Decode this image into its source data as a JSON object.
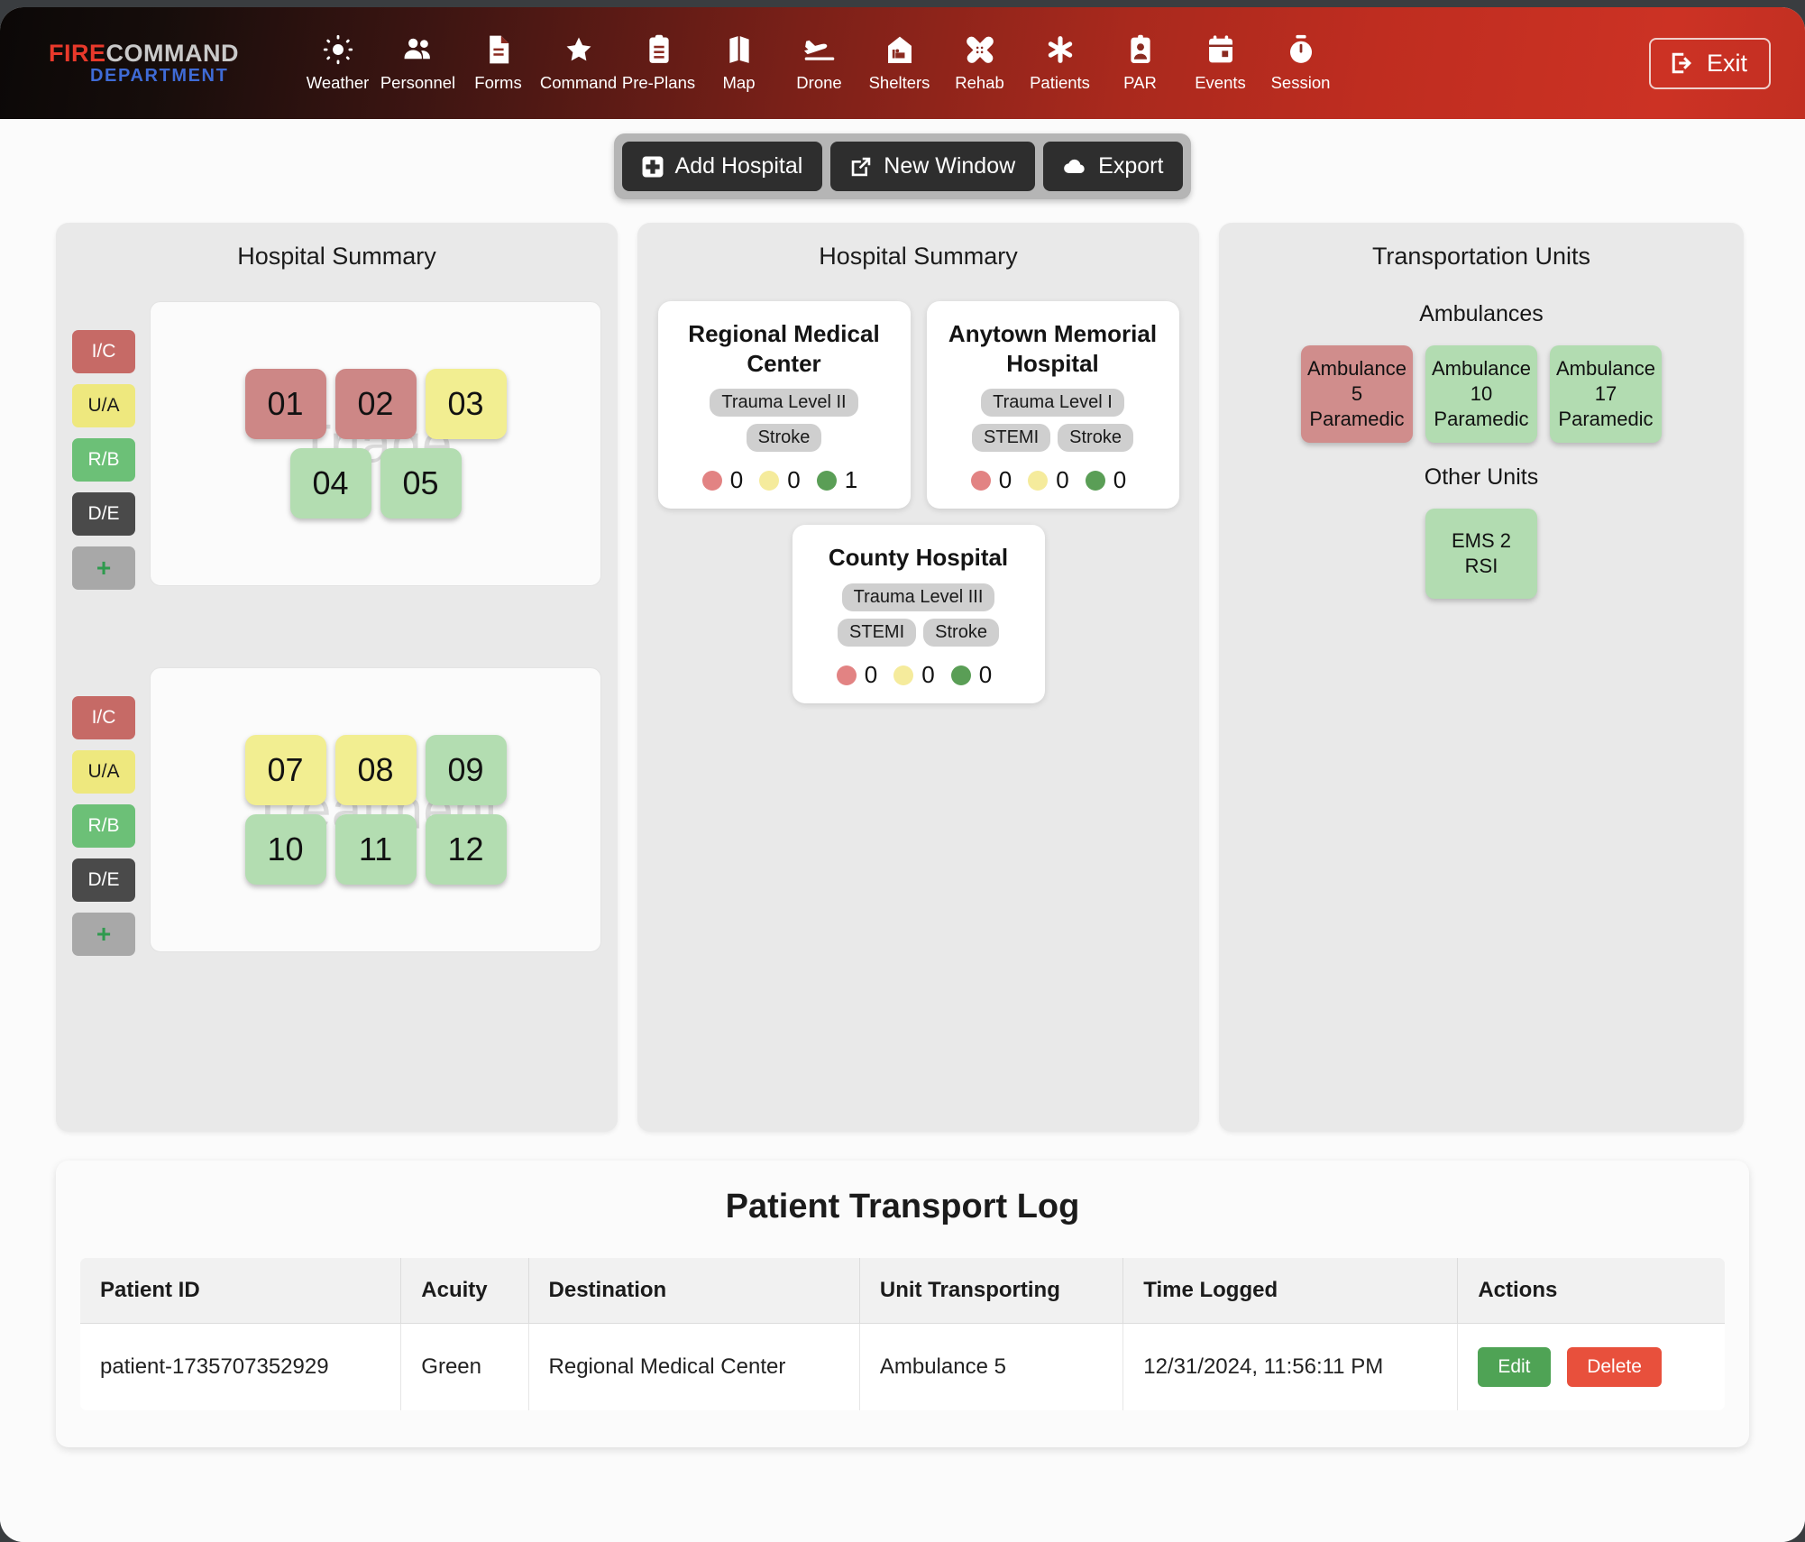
{
  "brand": {
    "line1_a": "FIRE",
    "line1_b": "COMMAND",
    "line2": "DEPARTMENT"
  },
  "nav": {
    "items": [
      {
        "label": "Weather",
        "icon": "sun-icon"
      },
      {
        "label": "Personnel",
        "icon": "people-icon"
      },
      {
        "label": "Forms",
        "icon": "document-icon"
      },
      {
        "label": "Command",
        "icon": "star-icon"
      },
      {
        "label": "Pre-Plans",
        "icon": "clipboard-icon"
      },
      {
        "label": "Map",
        "icon": "map-icon"
      },
      {
        "label": "Drone",
        "icon": "plane-landing-icon"
      },
      {
        "label": "Shelters",
        "icon": "shelter-bed-icon"
      },
      {
        "label": "Rehab",
        "icon": "bandage-icon"
      },
      {
        "label": "Patients",
        "icon": "asterisk-icon"
      },
      {
        "label": "PAR",
        "icon": "id-badge-icon"
      },
      {
        "label": "Events",
        "icon": "calendar-icon"
      },
      {
        "label": "Session",
        "icon": "stopwatch-icon"
      }
    ],
    "exit_label": "Exit",
    "exit_icon": "exit-arrow-icon"
  },
  "toolbar": {
    "add_hospital": "Add Hospital",
    "new_window": "New Window",
    "export": "Export",
    "add_hospital_icon": "hospital-plus-icon",
    "new_window_icon": "external-link-icon",
    "export_icon": "cloud-download-icon"
  },
  "left_panel": {
    "title": "Hospital Summary",
    "status_buttons": [
      {
        "label": "I/C",
        "cls": "s-ic"
      },
      {
        "label": "U/A",
        "cls": "s-ua"
      },
      {
        "label": "R/B",
        "cls": "s-rb"
      },
      {
        "label": "D/E",
        "cls": "s-de"
      },
      {
        "label": "+",
        "cls": "s-add"
      }
    ],
    "zones": [
      {
        "watermark": "Triage",
        "tiles": [
          {
            "label": "01",
            "color": "c-red"
          },
          {
            "label": "02",
            "color": "c-red"
          },
          {
            "label": "03",
            "color": "c-yellow"
          },
          {
            "label": "04",
            "color": "c-green"
          },
          {
            "label": "05",
            "color": "c-green"
          }
        ]
      },
      {
        "watermark": "Treatment",
        "tiles": [
          {
            "label": "07",
            "color": "c-yellow"
          },
          {
            "label": "08",
            "color": "c-yellow"
          },
          {
            "label": "09",
            "color": "c-green"
          },
          {
            "label": "10",
            "color": "c-green"
          },
          {
            "label": "11",
            "color": "c-green"
          },
          {
            "label": "12",
            "color": "c-green"
          }
        ]
      }
    ]
  },
  "mid_panel": {
    "title": "Hospital Summary",
    "hospitals": [
      {
        "name": "Regional Medical Center",
        "tags": [
          "Trauma Level II",
          "Stroke"
        ],
        "counts": {
          "red": "0",
          "yellow": "0",
          "green": "1"
        }
      },
      {
        "name": "Anytown Memorial Hospital",
        "tags": [
          "Trauma Level I",
          "STEMI",
          "Stroke"
        ],
        "counts": {
          "red": "0",
          "yellow": "0",
          "green": "0"
        }
      },
      {
        "name": "County Hospital",
        "tags": [
          "Trauma Level III",
          "STEMI",
          "Stroke"
        ],
        "counts": {
          "red": "0",
          "yellow": "0",
          "green": "0"
        }
      }
    ]
  },
  "right_panel": {
    "title": "Transportation Units",
    "ambulances_title": "Ambulances",
    "ambulances": [
      {
        "line1": "Ambulance",
        "line2": "5",
        "line3": "Paramedic",
        "color": "u-red"
      },
      {
        "line1": "Ambulance",
        "line2": "10",
        "line3": "Paramedic",
        "color": "u-green"
      },
      {
        "line1": "Ambulance",
        "line2": "17",
        "line3": "Paramedic",
        "color": "u-green"
      }
    ],
    "other_title": "Other Units",
    "other_units": [
      {
        "line1": "EMS 2",
        "line2": "RSI",
        "line3": "",
        "color": "u-green"
      }
    ]
  },
  "transport_log": {
    "title": "Patient Transport Log",
    "columns": [
      "Patient ID",
      "Acuity",
      "Destination",
      "Unit Transporting",
      "Time Logged",
      "Actions"
    ],
    "rows": [
      {
        "patient_id": "patient-1735707352929",
        "acuity": "Green",
        "destination": "Regional Medical Center",
        "unit": "Ambulance 5",
        "time": "12/31/2024, 11:56:11 PM",
        "edit_label": "Edit",
        "delete_label": "Delete"
      }
    ]
  },
  "colors": {
    "brand_red": "#e8392b",
    "brand_blue": "#3f6bd6",
    "nav_gradient_end": "#cc3224",
    "red_tile": "#cd8786",
    "yellow_tile": "#f2ee91",
    "green_tile": "#b3ddb1",
    "edit_green": "#4fa355",
    "delete_red": "#e8503c"
  }
}
